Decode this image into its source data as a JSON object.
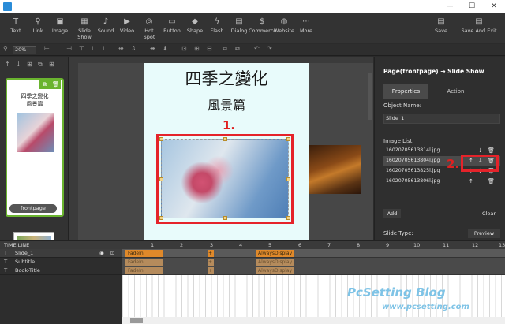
{
  "toolbar": {
    "items": [
      {
        "label": "Text",
        "icon": "T"
      },
      {
        "label": "Link",
        "icon": "⚲"
      },
      {
        "label": "Image",
        "icon": "▣"
      },
      {
        "label": "Slide Show",
        "icon": "▦"
      },
      {
        "label": "Sound",
        "icon": "♪"
      },
      {
        "label": "Video",
        "icon": "▶"
      },
      {
        "label": "Hot Spot",
        "icon": "◎"
      },
      {
        "label": "Button",
        "icon": "▭"
      },
      {
        "label": "Shape",
        "icon": "◆"
      },
      {
        "label": "Flash",
        "icon": "ϟ"
      },
      {
        "label": "Dialog",
        "icon": "▤"
      },
      {
        "label": "Commerce",
        "icon": "$"
      },
      {
        "label": "Website",
        "icon": "◍"
      },
      {
        "label": "More",
        "icon": "⋯"
      }
    ],
    "save_label": "Save",
    "save_exit_label": "Save And Exit"
  },
  "zoom": "20%",
  "pages": {
    "thumb1_title": "四季之變化",
    "thumb1_subtitle": "風景篇",
    "thumb1_label": "frontpage"
  },
  "canvas": {
    "title": "四季之變化",
    "subtitle": "風景篇",
    "callout1": "1.",
    "callout2": "2."
  },
  "properties": {
    "panel_title": "Page(frontpage) → Slide Show",
    "tab_properties": "Properties",
    "tab_action": "Action",
    "object_name_label": "Object Name:",
    "object_name_value": "Slide_1",
    "image_list_label": "Image List",
    "images": [
      "16020705613814l.jpg",
      "16020705613804l.jpg",
      "16020705613825l.jpg",
      "16020705613806l.jpg"
    ],
    "add_label": "Add",
    "clear_label": "Clear",
    "slide_type_label": "Slide Type:",
    "slide_type_value": "Preview"
  },
  "timeline": {
    "header_label": "TIME LINE",
    "ticks": [
      "1",
      "2",
      "3",
      "4",
      "5",
      "6",
      "7",
      "8",
      "9",
      "10",
      "11",
      "12",
      "13"
    ],
    "rows": [
      {
        "name": "Slide_1",
        "clip1": "FadeIn",
        "clip2": "AlwaysDisplay"
      },
      {
        "name": "Subtitle",
        "clip1": "FadeIn",
        "clip2": "AlwaysDisplay"
      },
      {
        "name": "Book-Title",
        "clip1": "FadeIn",
        "clip2": "AlwaysDisplay"
      }
    ]
  },
  "watermark": {
    "line1": "PcSetting Blog",
    "line2": "www.pcsetting.com"
  }
}
